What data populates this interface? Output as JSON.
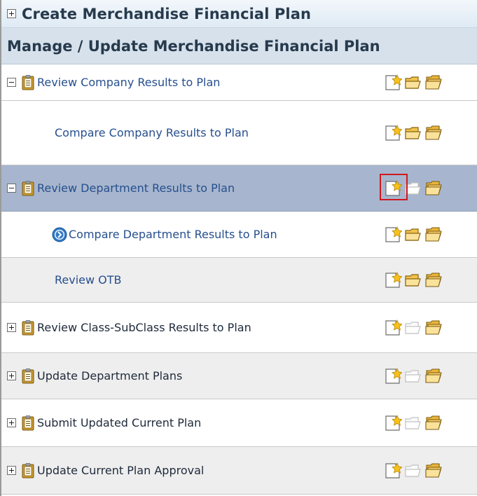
{
  "create_section": {
    "title": "Create Merchandise Financial Plan"
  },
  "manage_section": {
    "title": "Manage / Update Merchandise Financial Plan"
  },
  "rows": [
    {
      "label": "Review Company Results to Plan"
    },
    {
      "label": "Compare Company Results to Plan"
    },
    {
      "label": "Review Department Results to Plan"
    },
    {
      "label": "Compare Department Results to Plan"
    },
    {
      "label": "Review OTB"
    },
    {
      "label": "Review Class-SubClass Results to Plan"
    },
    {
      "label": "Update Department Plans"
    },
    {
      "label": "Submit Updated Current Plan"
    },
    {
      "label": "Update Current Plan Approval"
    }
  ],
  "colors": {
    "selected_row": "#a7b6ce",
    "highlight": "#d0191d",
    "link_text": "#264f8e",
    "header_bg": "#d6e1eb"
  }
}
